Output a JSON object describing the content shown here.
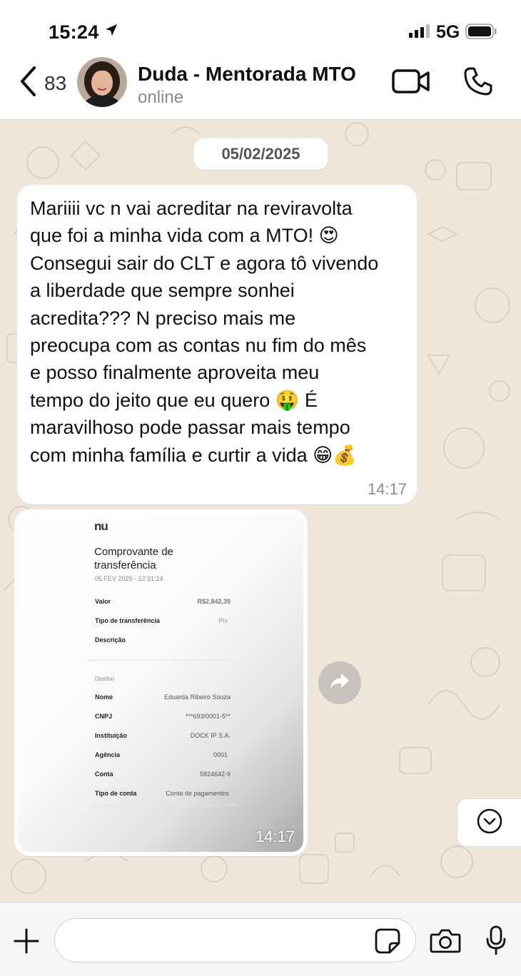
{
  "status_bar": {
    "time": "15:24",
    "network": "5G"
  },
  "header": {
    "back_count": "83",
    "contact_name": "Duda - Mentorada MTO",
    "contact_status": "online"
  },
  "chat": {
    "date_divider": "05/02/2025",
    "messages": [
      {
        "type": "text",
        "lines": [
          "Mariiii vc n vai acreditar na reviravolta",
          "que foi a minha vida com a MTO! 😍",
          "Consegui sair do CLT e agora tô vivendo",
          "a liberdade que sempre sonhei",
          "acredita??? N preciso mais me",
          "preocupa com as contas nu fim do mês",
          "e posso finalmente aproveita meu",
          "tempo do jeito que eu quero 🤑 É",
          "maravilhoso pode passar mais tempo",
          "com minha família e curtir a vida 😁💰"
        ],
        "time": "14:17"
      },
      {
        "type": "image",
        "time": "14:17",
        "receipt": {
          "logo": "nu",
          "title_line1": "Comprovante de",
          "title_line2": "transferência",
          "date": "05 FEV 2025 - 12:31:14",
          "fields": [
            {
              "label": "Valor",
              "value": "R$2.842,35"
            },
            {
              "label": "Tipo de transferência",
              "value": "Pix"
            },
            {
              "label": "Descrição",
              "value": ""
            }
          ],
          "section": "Destino",
          "destination": [
            {
              "label": "Nome",
              "value": "Eduarda Ribeiro Souza"
            },
            {
              "label": "CNPJ",
              "value": "***693/0001-5**"
            },
            {
              "label": "Instituição",
              "value": "DOCK IP S.A."
            },
            {
              "label": "Agência",
              "value": "0001"
            },
            {
              "label": "Conta",
              "value": "5824642-9"
            },
            {
              "label": "Tipo de conta",
              "value": "Conta de pagamentos"
            }
          ]
        }
      }
    ]
  },
  "input": {
    "value": "",
    "placeholder": ""
  },
  "icons": {
    "location": "location-arrow-icon",
    "signal": "cellular-signal-icon",
    "battery": "battery-icon",
    "back": "chevron-left-icon",
    "video": "video-camera-icon",
    "call": "phone-icon",
    "forward": "forward-arrow-icon",
    "scroll": "chevron-down-icon",
    "plus": "plus-icon",
    "sticker": "sticker-icon",
    "camera": "camera-icon",
    "mic": "microphone-icon"
  },
  "colors": {
    "chat_background": "#efe7dc",
    "bubble": "#ffffff",
    "timestamp": "#8d8d8d"
  }
}
